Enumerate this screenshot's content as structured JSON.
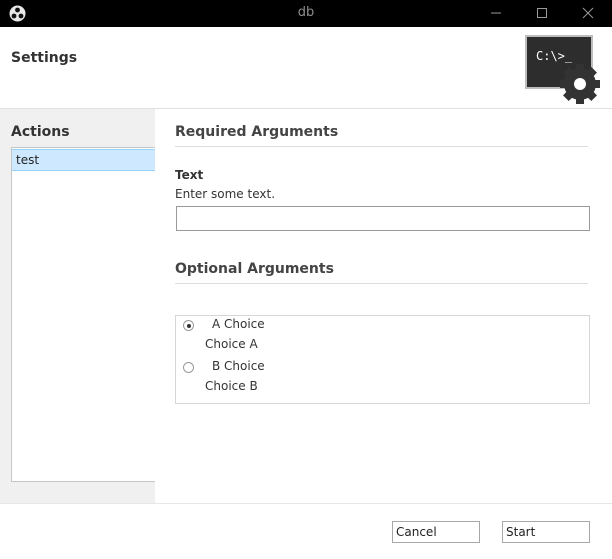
{
  "window": {
    "title": "db",
    "app_icon": "app-icon",
    "controls": [
      "minimize-icon",
      "maximize-icon",
      "close-icon"
    ]
  },
  "header": {
    "title": "Settings",
    "logo": {
      "text": "C:\\>_",
      "icon": "terminal-gear-icon"
    }
  },
  "sidebar": {
    "heading": "Actions",
    "items": [
      {
        "label": "test",
        "selected": true
      }
    ]
  },
  "main": {
    "required": {
      "heading": "Required Arguments",
      "field": {
        "label": "Text",
        "help": "Enter some text.",
        "value": "",
        "placeholder": ""
      }
    },
    "optional": {
      "heading": "Optional Arguments",
      "choices": [
        {
          "label": "A Choice",
          "description": "Choice A",
          "selected": true
        },
        {
          "label": "B Choice",
          "description": "Choice B",
          "selected": false
        }
      ]
    }
  },
  "footer": {
    "cancel_label": "Cancel",
    "start_label": "Start"
  },
  "colors": {
    "titlebar": "#000000",
    "selection": "#cde8ff",
    "sidebar_bg": "#f0f0f0"
  }
}
